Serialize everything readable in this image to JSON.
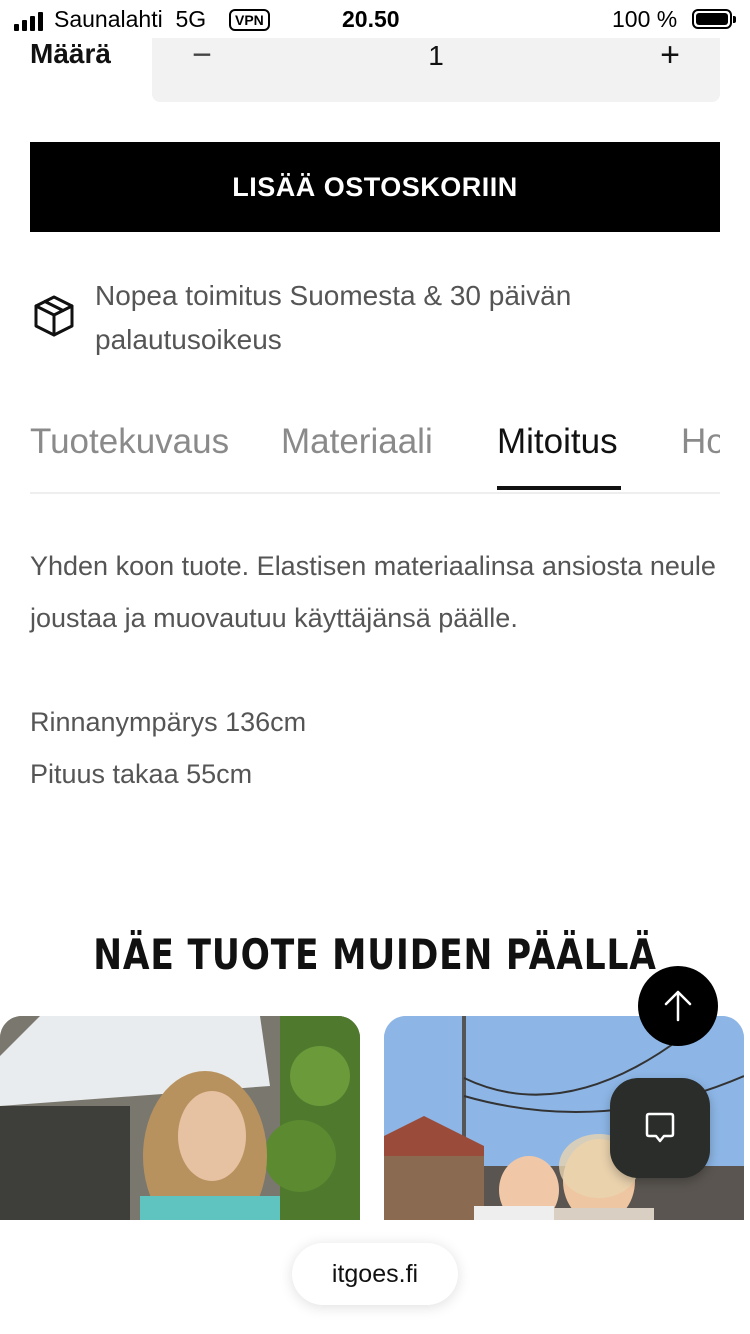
{
  "status_bar": {
    "carrier": "Saunalahti",
    "network": "5G",
    "vpn": "VPN",
    "time": "20.50",
    "battery": "100 %"
  },
  "quantity": {
    "label": "Määrä",
    "decrement": "−",
    "value": "1",
    "increment": "+"
  },
  "add_to_cart": "LISÄÄ OSTOSKORIIN",
  "shipping_info": {
    "icon": "package-icon",
    "text": "Nopea toimitus Suomesta & 30 päivän palautusoikeus"
  },
  "tabs": [
    {
      "label": "Tuotekuvaus",
      "active": false
    },
    {
      "label": "Materiaali",
      "active": false
    },
    {
      "label": "Mitoitus",
      "active": true
    },
    {
      "label": "Hoito",
      "active": false
    }
  ],
  "sizing": {
    "description": "Yhden koon tuote. Elastisen materiaalinsa ansiosta neule joustaa ja muovautuu käyttäjänsä päälle.",
    "bust": "Rinnanympärys 136cm",
    "back_length": "Pituus takaa 55cm"
  },
  "gallery": {
    "title": "NÄE TUOTE MUIDEN PÄÄLLÄ"
  },
  "floating": {
    "scroll_top_icon": "arrow-up-icon",
    "chat_icon": "chat-bubble-icon"
  },
  "browser": {
    "url": "itgoes.fi"
  },
  "colors": {
    "button_bg": "#000000",
    "text_muted": "#555555",
    "tab_inactive": "#8a8a8a"
  }
}
